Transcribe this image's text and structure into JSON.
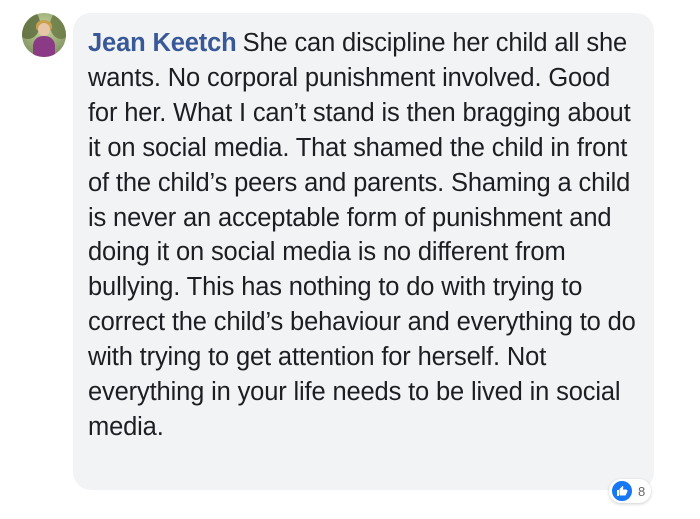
{
  "comment": {
    "author": "Jean Keetch",
    "text": "She can discipline her child all she wants. No corporal punishment involved. Good for her. What I can’t stand is then bragging about it on social media. That shamed the child in front of the child’s peers and parents. Shaming a child is never an acceptable form of punishment and doing it on social media is no different from bullying. This has nothing to do with trying to correct the child’s behaviour and everything to do with trying to get attention for herself. Not everything in your life needs to be lived in social media."
  },
  "reactions": {
    "icon": "like-icon",
    "count": "8"
  },
  "colors": {
    "author_name": "#385898",
    "bubble_background": "#f2f3f5",
    "text": "#1c1e21",
    "like_blue": "#1877f2"
  }
}
